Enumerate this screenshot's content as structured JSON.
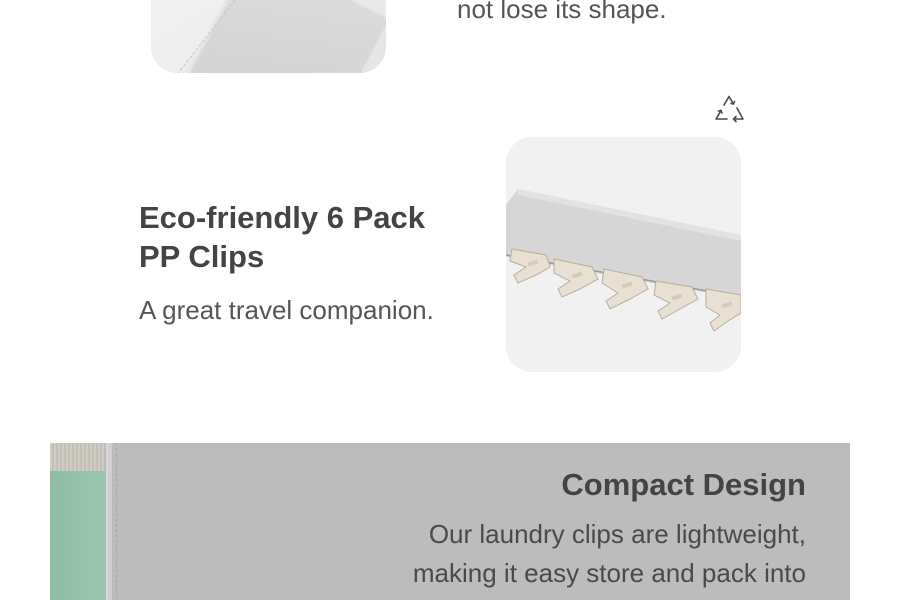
{
  "top_section": {
    "text": "not lose its shape."
  },
  "eco_section": {
    "icon": "recycle-icon",
    "title": "Eco-friendly 6 Pack PP Clips",
    "subtitle": "A great travel companion."
  },
  "compact_section": {
    "title": "Compact Design",
    "text": "Our laundry clips are lightweight, making it easy store and pack into"
  },
  "colors": {
    "text_dark": "#444444",
    "banner_gray": "#bcbcbc",
    "accent_green": "#9ac6af"
  }
}
